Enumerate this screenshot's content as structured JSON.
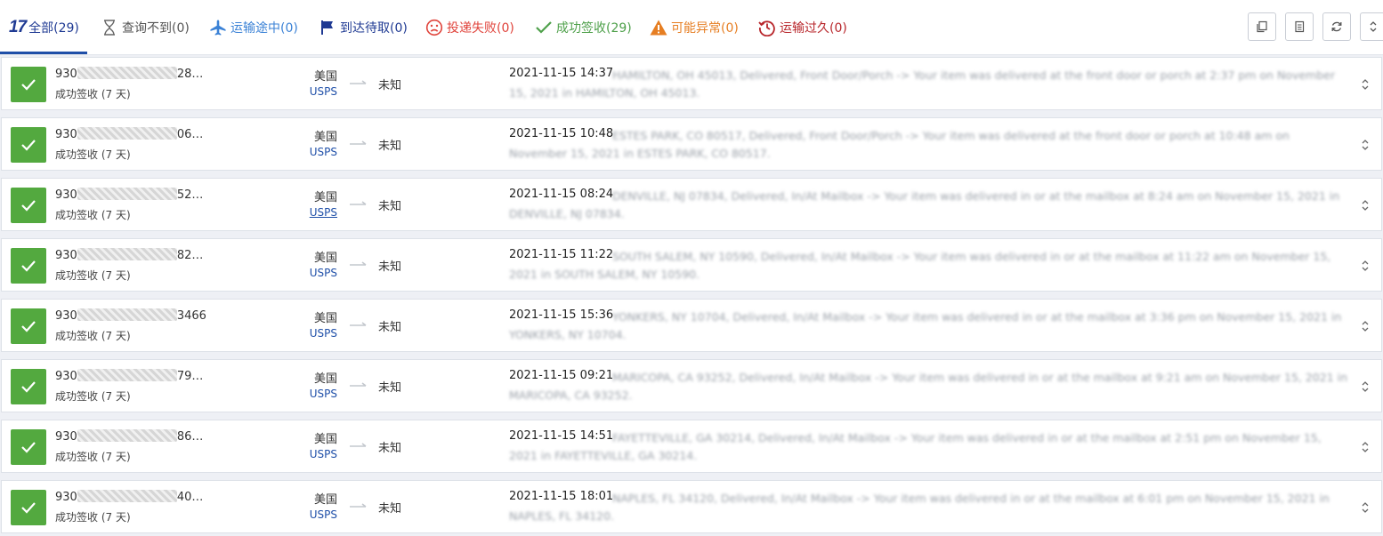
{
  "tabs": [
    {
      "label": "全部(29)",
      "icon": "logo-17-icon"
    },
    {
      "label": "查询不到(0)",
      "icon": "hourglass-icon"
    },
    {
      "label": "运输途中(0)",
      "icon": "airplane-icon"
    },
    {
      "label": "到达待取(0)",
      "icon": "flag-icon"
    },
    {
      "label": "投递失败(0)",
      "icon": "sad-face-icon"
    },
    {
      "label": "成功签收(29)",
      "icon": "checkmark-icon"
    },
    {
      "label": "可能异常(0)",
      "icon": "warning-icon"
    },
    {
      "label": "运输过久(0)",
      "icon": "clock-history-icon"
    }
  ],
  "logo_text": "17",
  "toolbar": [
    "copy-icon",
    "paste-list-icon",
    "refresh-icon",
    "expand-all-icon"
  ],
  "colors": {
    "accent": "#1f3a93",
    "delivered": "#53a93f",
    "transit": "#3b82d6",
    "failed": "#e0443c",
    "alert": "#e67e22",
    "expired": "#b8262b"
  },
  "rows": [
    {
      "tracking_prefix": "930",
      "tracking_suffix": "28…",
      "status": "成功签收 (7 天)",
      "origin": "美国",
      "carrier": "USPS",
      "destination": "未知",
      "time": "2021-11-15 14:37",
      "event": "HAMILTON, OH 45013, Delivered, Front Door/Porch -> Your item was delivered at the front door or porch at 2:37 pm on November 15, 2021 in HAMILTON, OH 45013."
    },
    {
      "tracking_prefix": "930",
      "tracking_suffix": "06…",
      "status": "成功签收 (7 天)",
      "origin": "美国",
      "carrier": "USPS",
      "destination": "未知",
      "time": "2021-11-15 10:48",
      "event": "ESTES PARK, CO 80517, Delivered, Front Door/Porch -> Your item was delivered at the front door or porch at 10:48 am on November 15, 2021 in ESTES PARK, CO 80517."
    },
    {
      "tracking_prefix": "930",
      "tracking_suffix": "52…",
      "status": "成功签收 (7 天)",
      "origin": "美国",
      "carrier": "USPS",
      "destination": "未知",
      "time": "2021-11-15 08:24",
      "event": "DENVILLE, NJ 07834, Delivered, In/At Mailbox -> Your item was delivered in or at the mailbox at 8:24 am on November 15, 2021 in DENVILLE, NJ 07834."
    },
    {
      "tracking_prefix": "930",
      "tracking_suffix": "82…",
      "status": "成功签收 (7 天)",
      "origin": "美国",
      "carrier": "USPS",
      "destination": "未知",
      "time": "2021-11-15 11:22",
      "event": "SOUTH SALEM, NY 10590, Delivered, In/At Mailbox -> Your item was delivered in or at the mailbox at 11:22 am on November 15, 2021 in SOUTH SALEM, NY 10590."
    },
    {
      "tracking_prefix": "930",
      "tracking_suffix": "3466",
      "status": "成功签收 (7 天)",
      "origin": "美国",
      "carrier": "USPS",
      "destination": "未知",
      "time": "2021-11-15 15:36",
      "event": "YONKERS, NY 10704, Delivered, In/At Mailbox -> Your item was delivered in or at the mailbox at 3:36 pm on November 15, 2021 in YONKERS, NY 10704."
    },
    {
      "tracking_prefix": "930",
      "tracking_suffix": "79…",
      "status": "成功签收 (7 天)",
      "origin": "美国",
      "carrier": "USPS",
      "destination": "未知",
      "time": "2021-11-15 09:21",
      "event": "MARICOPA, CA 93252, Delivered, In/At Mailbox -> Your item was delivered in or at the mailbox at 9:21 am on November 15, 2021 in MARICOPA, CA 93252."
    },
    {
      "tracking_prefix": "930",
      "tracking_suffix": "86…",
      "status": "成功签收 (7 天)",
      "origin": "美国",
      "carrier": "USPS",
      "destination": "未知",
      "time": "2021-11-15 14:51",
      "event": "FAYETTEVILLE, GA 30214, Delivered, In/At Mailbox -> Your item was delivered in or at the mailbox at 2:51 pm on November 15, 2021 in FAYETTEVILLE, GA 30214."
    },
    {
      "tracking_prefix": "930",
      "tracking_suffix": "40…",
      "status": "成功签收 (7 天)",
      "origin": "美国",
      "carrier": "USPS",
      "destination": "未知",
      "time": "2021-11-15 18:01",
      "event": "NAPLES, FL 34120, Delivered, In/At Mailbox -> Your item was delivered in or at the mailbox at 6:01 pm on November 15, 2021 in NAPLES, FL 34120."
    }
  ]
}
